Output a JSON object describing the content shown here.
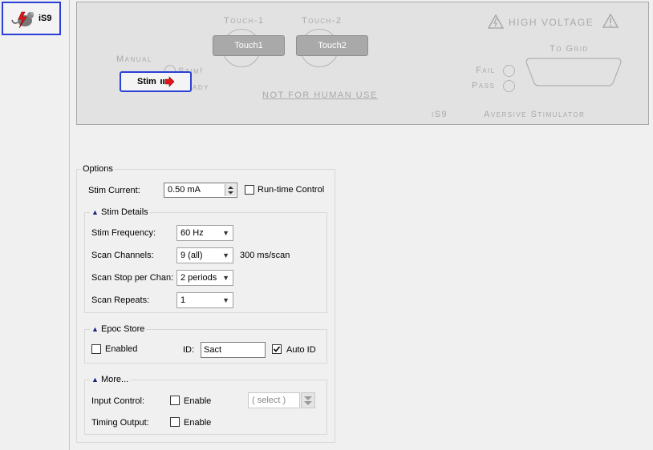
{
  "sidebar": {
    "device_label": "iS9"
  },
  "panel": {
    "touch1_etch": "Touch-1",
    "touch2_etch": "Touch-2",
    "touch1_button": "Touch1",
    "touch2_button": "Touch2",
    "high_voltage": "HIGH VOLTAGE",
    "manual": "Manual",
    "stim_label": "Stim!",
    "ready_label": "ady",
    "stim_button": "Stim",
    "not_human": "NOT FOR HUMAN USE",
    "fail": "Fail",
    "pass": "Pass",
    "to_grid": "To Grid",
    "model": "iS9",
    "aversive": "Aversive Stimulator"
  },
  "options": {
    "title": "Options",
    "stim_current_label": "Stim Current:",
    "stim_current_value": "0.50 mA",
    "runtime_control": "Run-time Control",
    "stim_details": {
      "title": "Stim Details",
      "frequency_label": "Stim Frequency:",
      "frequency_value": "60 Hz",
      "channels_label": "Scan Channels:",
      "channels_value": "9 (all)",
      "scan_rate": "300 ms/scan",
      "stop_label": "Scan Stop per Chan:",
      "stop_value": "2 periods",
      "repeats_label": "Scan Repeats:",
      "repeats_value": "1"
    },
    "epoc_store": {
      "title": "Epoc Store",
      "enabled_label": "Enabled",
      "id_label": "ID:",
      "id_value": "Sact",
      "auto_id": "Auto ID"
    },
    "more": {
      "title": "More...",
      "input_control_label": "Input Control:",
      "input_enable": "Enable",
      "select_placeholder": "( select )",
      "timing_output_label": "Timing Output:",
      "timing_enable": "Enable"
    }
  },
  "colors": {
    "accent": "#2a3fd6",
    "arrow_red": "#e0161b",
    "etch_gray": "#a9a9a9"
  }
}
